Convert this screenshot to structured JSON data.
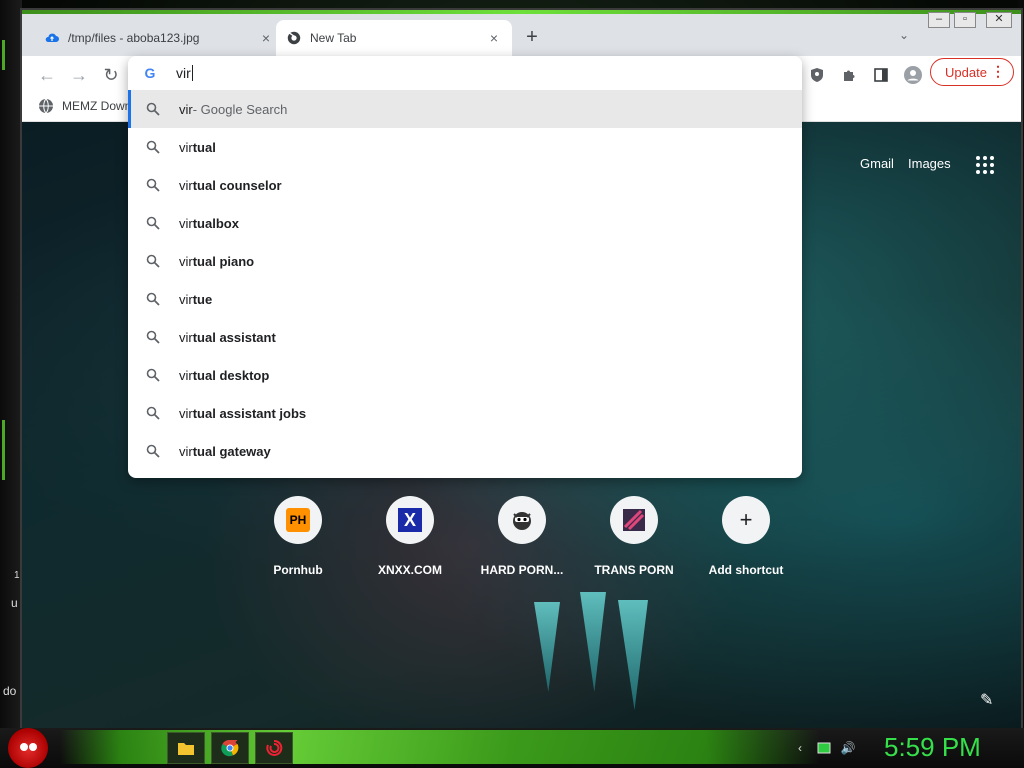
{
  "desktop": {
    "side_labels": [
      "u",
      "do",
      "1"
    ]
  },
  "browser": {
    "tabs": [
      {
        "title": "/tmp/files - aboba123.jpg",
        "active": false
      },
      {
        "title": "New Tab",
        "active": true
      }
    ],
    "new_tab_symbol": "+",
    "tab_close_symbol": "×",
    "update_label": "Update",
    "bookmark": {
      "label": "MEMZ Down"
    },
    "omnibox": {
      "query": "vir",
      "suggestions": [
        {
          "prefix": "vir",
          "rest": "",
          "suffix": " - Google Search",
          "selected": true
        },
        {
          "prefix": "vir",
          "rest": "tual",
          "suffix": ""
        },
        {
          "prefix": "vir",
          "rest": "tual counselor",
          "suffix": ""
        },
        {
          "prefix": "vir",
          "rest": "tualbox",
          "suffix": ""
        },
        {
          "prefix": "vir",
          "rest": "tual piano",
          "suffix": ""
        },
        {
          "prefix": "vir",
          "rest": "tue",
          "suffix": ""
        },
        {
          "prefix": "vir",
          "rest": "tual assistant",
          "suffix": ""
        },
        {
          "prefix": "vir",
          "rest": "tual desktop",
          "suffix": ""
        },
        {
          "prefix": "vir",
          "rest": "tual assistant jobs",
          "suffix": ""
        },
        {
          "prefix": "vir",
          "rest": "tual gateway",
          "suffix": ""
        }
      ]
    },
    "ntp": {
      "gmail": "Gmail",
      "images": "Images",
      "shortcuts": [
        {
          "label": "Pornhub",
          "logo_text": "PH"
        },
        {
          "label": "XNXX.COM",
          "logo_text": "X"
        },
        {
          "label": "HARD PORN...",
          "logo_text": ""
        },
        {
          "label": "TRANS PORN",
          "logo_text": ""
        },
        {
          "label": "Add shortcut",
          "logo_text": "+"
        }
      ]
    }
  },
  "taskbar": {
    "clock": "5:59 PM",
    "clock_color": "#35e04a"
  },
  "colors": {
    "accent": "#1a73e8",
    "update": "#d93025",
    "taskbar_glow": "#6ee03a"
  }
}
